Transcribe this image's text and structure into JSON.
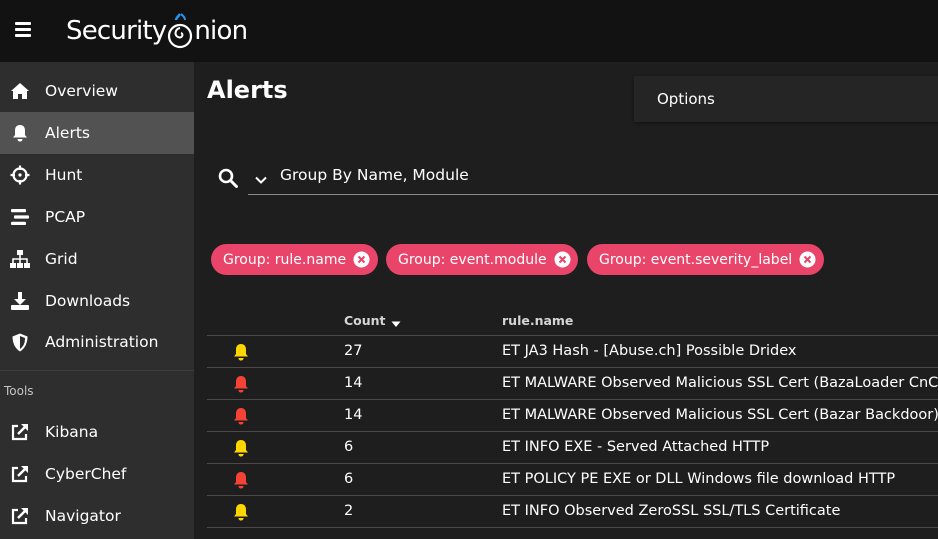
{
  "app": {
    "logo_text_left": "Security",
    "logo_text_right": "nion"
  },
  "sidebar": {
    "items": [
      {
        "label": "Overview",
        "icon": "home-icon"
      },
      {
        "label": "Alerts",
        "icon": "bell-icon",
        "active": true
      },
      {
        "label": "Hunt",
        "icon": "crosshairs-icon"
      },
      {
        "label": "PCAP",
        "icon": "stream-icon"
      },
      {
        "label": "Grid",
        "icon": "sitemap-icon"
      },
      {
        "label": "Downloads",
        "icon": "download-icon"
      },
      {
        "label": "Administration",
        "icon": "shield-icon"
      }
    ],
    "tools_label": "Tools",
    "tools": [
      {
        "label": "Kibana",
        "icon": "external-link-icon"
      },
      {
        "label": "CyberChef",
        "icon": "external-link-icon"
      },
      {
        "label": "Navigator",
        "icon": "external-link-icon"
      }
    ]
  },
  "main": {
    "title": "Alerts",
    "options_label": "Options",
    "query": "Group By Name, Module"
  },
  "chips": [
    {
      "label": "Group: rule.name"
    },
    {
      "label": "Group: event.module"
    },
    {
      "label": "Group: event.severity_label"
    }
  ],
  "table": {
    "headers": {
      "count": "Count",
      "rule": "rule.name"
    },
    "rows": [
      {
        "severity": "yellow",
        "count": "27",
        "rule": "ET JA3 Hash - [Abuse.ch] Possible Dridex"
      },
      {
        "severity": "red",
        "count": "14",
        "rule": "ET MALWARE Observed Malicious SSL Cert (BazaLoader CnC)"
      },
      {
        "severity": "red",
        "count": "14",
        "rule": "ET MALWARE Observed Malicious SSL Cert (Bazar Backdoor)"
      },
      {
        "severity": "yellow",
        "count": "6",
        "rule": "ET INFO EXE - Served Attached HTTP"
      },
      {
        "severity": "red",
        "count": "6",
        "rule": "ET POLICY PE EXE or DLL Windows file download HTTP"
      },
      {
        "severity": "yellow",
        "count": "2",
        "rule": "ET INFO Observed ZeroSSL SSL/TLS Certificate"
      }
    ]
  },
  "colors": {
    "chip": "#e9446a",
    "sev_yellow": "#ffd600",
    "sev_red": "#f44336",
    "active_nav": "#525252"
  }
}
